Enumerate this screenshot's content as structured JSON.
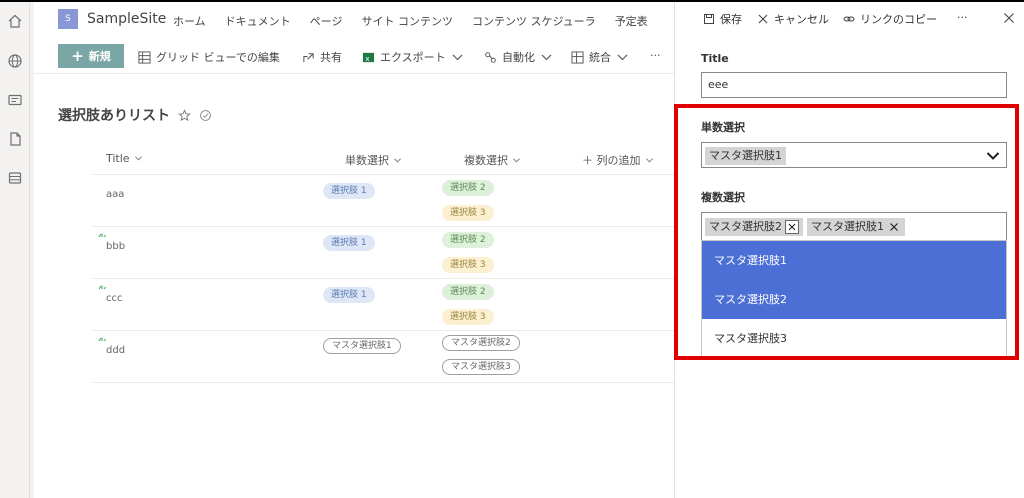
{
  "site": {
    "logo_letter": "S",
    "name": "SampleSite",
    "nav": [
      "ホーム",
      "ドキュメント",
      "ページ",
      "サイト コンテンツ",
      "コンテンツ スケジューラ",
      "予定表"
    ]
  },
  "commandbar": {
    "new_label": "新規",
    "grid_edit_label": "グリッド ビューでの編集",
    "share_label": "共有",
    "export_label": "エクスポート",
    "automate_label": "自動化",
    "integrate_label": "統合",
    "more_label": "···"
  },
  "list": {
    "title": "選択肢ありリスト",
    "columns": {
      "title": "Title",
      "single": "単数選択",
      "multi": "複数選択",
      "add_column": "＋ 列の追加"
    },
    "rows": [
      {
        "title": "aaa",
        "single": "選択肢 1",
        "single_style": "blue",
        "multi": [
          {
            "label": "選択肢 2",
            "style": "green"
          },
          {
            "label": "選択肢 3",
            "style": "yellow"
          }
        ],
        "is_new": false
      },
      {
        "title": "bbb",
        "single": "選択肢 1",
        "single_style": "blue",
        "multi": [
          {
            "label": "選択肢 2",
            "style": "green"
          },
          {
            "label": "選択肢 3",
            "style": "yellow"
          }
        ],
        "is_new": true
      },
      {
        "title": "ccc",
        "single": "選択肢 1",
        "single_style": "blue",
        "multi": [
          {
            "label": "選択肢 2",
            "style": "green"
          },
          {
            "label": "選択肢 3",
            "style": "yellow"
          }
        ],
        "is_new": true
      },
      {
        "title": "ddd",
        "single": "マスタ選択肢1",
        "single_style": "outline",
        "multi": [
          {
            "label": "マスタ選択肢2",
            "style": "outline"
          },
          {
            "label": "マスタ選択肢3",
            "style": "outline"
          }
        ],
        "is_new": true
      }
    ]
  },
  "panel": {
    "save_label": "保存",
    "cancel_label": "キャンセル",
    "copy_link_label": "リンクのコピー",
    "more_label": "···",
    "title_label": "Title",
    "title_value": "eee",
    "single_label": "単数選択",
    "single_value": "マスタ選択肢1",
    "multi_label": "複数選択",
    "multi_values": [
      "マスタ選択肢2",
      "マスタ選択肢1"
    ],
    "options": [
      {
        "label": "マスタ選択肢1",
        "selected": true
      },
      {
        "label": "マスタ選択肢2",
        "selected": true
      },
      {
        "label": "マスタ選択肢3",
        "selected": false
      }
    ]
  },
  "colors": {
    "highlight": "#e00000",
    "selected_option": "#4b6fd4",
    "new_button": "#7aa6a6",
    "site_logo": "#8a97d6"
  },
  "icons": {
    "rail": [
      "home-icon",
      "globe-icon",
      "news-icon",
      "document-icon",
      "lists-icon"
    ],
    "commands": [
      "grid-icon",
      "share-icon",
      "excel-icon",
      "flow-icon",
      "apps-icon"
    ],
    "panel": [
      "save-icon",
      "cancel-icon",
      "link-icon",
      "close-icon"
    ]
  }
}
